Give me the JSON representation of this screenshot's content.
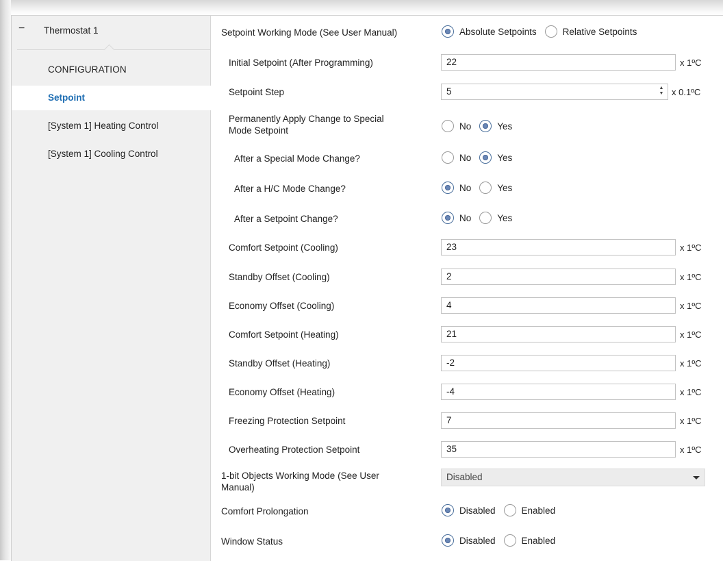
{
  "sidebar": {
    "header_label": "Thermostat 1",
    "collapse_symbol": "−",
    "items": [
      {
        "label": "CONFIGURATION"
      },
      {
        "label": "Setpoint"
      },
      {
        "label": "[System 1] Heating Control"
      },
      {
        "label": "[System 1] Cooling Control"
      }
    ]
  },
  "form": {
    "working_mode": {
      "label": "Setpoint Working Mode (See User Manual)",
      "options": [
        "Absolute Setpoints",
        "Relative Setpoints"
      ],
      "selected": "Absolute Setpoints"
    },
    "initial_setpoint": {
      "label": "Initial Setpoint (After Programming)",
      "value": "22",
      "unit": "x 1ºC"
    },
    "setpoint_step": {
      "label": "Setpoint Step",
      "value": "5",
      "unit": "x 0.1ºC",
      "spin_up": "▲",
      "spin_down": "▼"
    },
    "permanent_apply": {
      "label_line1": "Permanently Apply Change to Special",
      "label_line2": "Mode Setpoint",
      "options": [
        "No",
        "Yes"
      ],
      "selected": "Yes"
    },
    "after_special": {
      "label": "After a Special Mode Change?",
      "options": [
        "No",
        "Yes"
      ],
      "selected": "Yes"
    },
    "after_hc": {
      "label": "After a H/C Mode Change?",
      "options": [
        "No",
        "Yes"
      ],
      "selected": "No"
    },
    "after_setpoint": {
      "label": "After a Setpoint Change?",
      "options": [
        "No",
        "Yes"
      ],
      "selected": "No"
    },
    "comfort_cooling": {
      "label": "Comfort Setpoint (Cooling)",
      "value": "23",
      "unit": "x 1ºC"
    },
    "standby_cooling": {
      "label": "Standby Offset (Cooling)",
      "value": "2",
      "unit": "x 1ºC"
    },
    "economy_cooling": {
      "label": "Economy Offset (Cooling)",
      "value": "4",
      "unit": "x 1ºC"
    },
    "comfort_heating": {
      "label": "Comfort Setpoint (Heating)",
      "value": "21",
      "unit": "x 1ºC"
    },
    "standby_heating": {
      "label": "Standby Offset (Heating)",
      "value": "-2",
      "unit": "x 1ºC"
    },
    "economy_heating": {
      "label": "Economy Offset (Heating)",
      "value": "-4",
      "unit": "x 1ºC"
    },
    "freezing": {
      "label": "Freezing Protection Setpoint",
      "value": "7",
      "unit": "x 1ºC"
    },
    "overheating": {
      "label": "Overheating Protection Setpoint",
      "value": "35",
      "unit": "x 1ºC"
    },
    "onebit_mode": {
      "label_line1": "1-bit Objects Working Mode (See User",
      "label_line2": "Manual)",
      "value": "Disabled"
    },
    "comfort_prolongation": {
      "label": "Comfort Prolongation",
      "options": [
        "Disabled",
        "Enabled"
      ],
      "selected": "Disabled"
    },
    "window_status": {
      "label": "Window Status",
      "options": [
        "Disabled",
        "Enabled"
      ],
      "selected": "Disabled"
    }
  }
}
